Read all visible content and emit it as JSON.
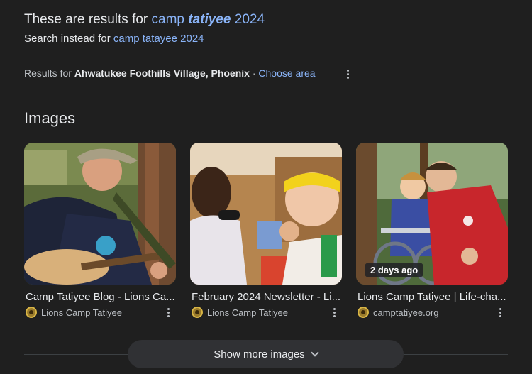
{
  "correction": {
    "prefix": "These are results for",
    "term_plain": "camp",
    "term_corrected": "tatiyee",
    "term_year": "2024"
  },
  "search_instead": {
    "prefix": "Search instead for",
    "link": "camp tatayee 2024"
  },
  "location": {
    "prefix": "Results for",
    "place": "Ahwatukee Foothills Village, Phoenix",
    "separator": "·",
    "choose_area": "Choose area",
    "more_icon": "more-vert-icon"
  },
  "images_section": {
    "title": "Images",
    "cards": [
      {
        "title": "Camp Tatiyee Blog - Lions Ca...",
        "source": "Lions Camp Tatiyee",
        "badge": ""
      },
      {
        "title": "February 2024 Newsletter - Li...",
        "source": "Lions Camp Tatiyee",
        "badge": ""
      },
      {
        "title": "Lions Camp Tatiyee | Life-cha...",
        "source": "camptatiyee.org",
        "badge": "2 days ago"
      }
    ],
    "show_more": "Show more images"
  },
  "colors": {
    "background": "#1f1f1f",
    "link": "#8ab4f8",
    "text": "#e8eaed",
    "muted": "#bdc1c6"
  }
}
